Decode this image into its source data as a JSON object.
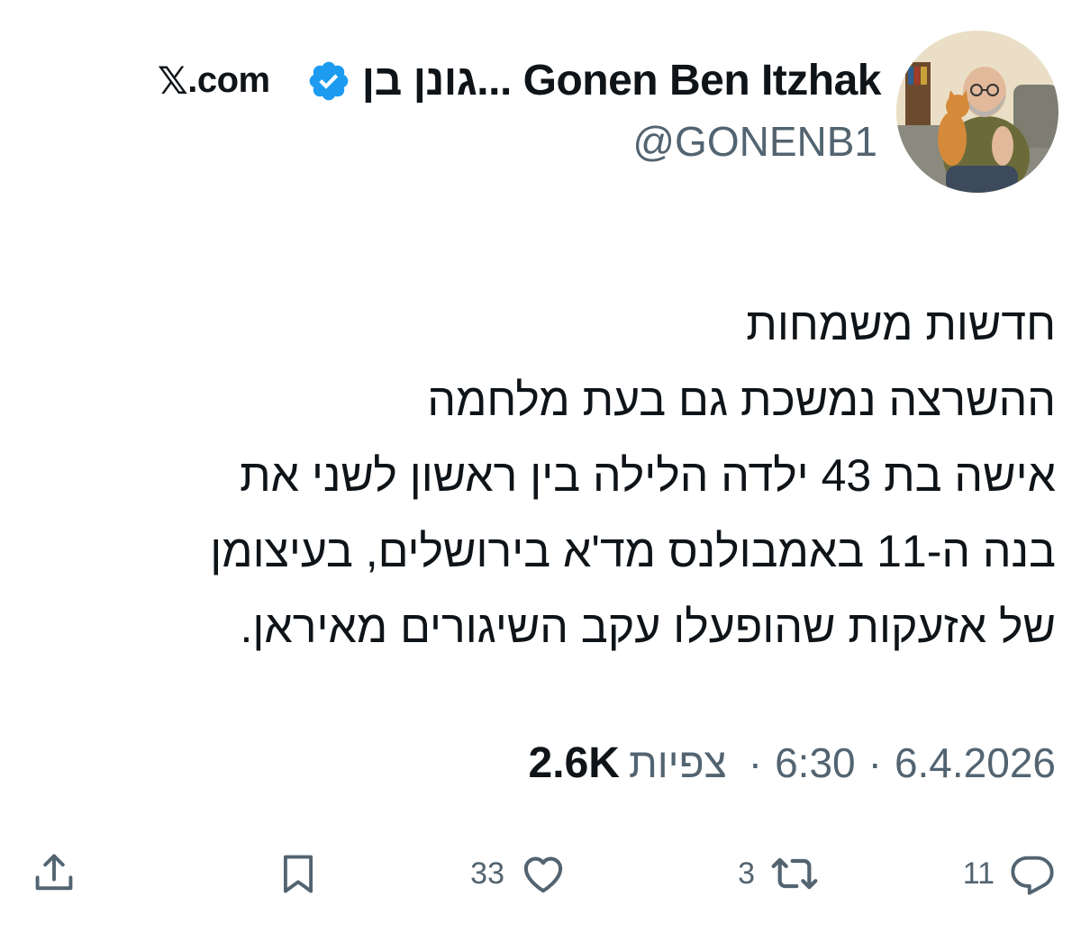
{
  "header": {
    "display_name": "גונן בן... Gonen Ben Itzhak",
    "handle": "@GONENB1",
    "brand": "com.",
    "brand_mark": "𝕏",
    "verified_icon": "verified-badge-icon",
    "verified_color": "#1d9bf0"
  },
  "tweet": {
    "lines": [
      "חדשות משמחות",
      "ההשרצה נמשכת גם בעת מלחמה",
      "אישה בת 43 ילדה הלילה בין ראשון לשני את",
      "בנה ה-11 באמבולנס מד'א בירושלים, בעיצומן",
      "של אזעקות שהופעלו עקב השיגורים מאיראן."
    ]
  },
  "meta": {
    "date": "6.4.2026",
    "time": "6:30",
    "separator": "·",
    "views_word": "צפיות",
    "views_count": "2.6K"
  },
  "actions": {
    "reply": {
      "icon": "reply-icon",
      "count": "11"
    },
    "repost": {
      "icon": "repost-icon",
      "count": "3"
    },
    "like": {
      "icon": "heart-icon",
      "count": "33"
    },
    "bookmark": {
      "icon": "bookmark-icon"
    },
    "share": {
      "icon": "share-icon"
    }
  },
  "colors": {
    "text_primary": "#0f1419",
    "text_secondary": "#536471",
    "background": "#ffffff"
  }
}
